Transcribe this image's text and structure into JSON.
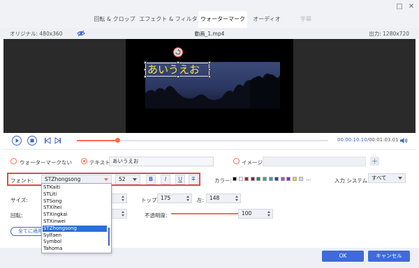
{
  "tabs": [
    {
      "label": "回転 & クロップ",
      "state": "normal"
    },
    {
      "label": "エフェクト & フィルター",
      "state": "normal"
    },
    {
      "label": "ウォーターマーク",
      "state": "active"
    },
    {
      "label": "オーディオ",
      "state": "normal"
    },
    {
      "label": "字幕",
      "state": "disabled"
    }
  ],
  "preview": {
    "original_label": "オリジナル: 480x360",
    "file_name": "動画_1.mp4",
    "output_label": "出力: 1280x720",
    "watermark_text": "あいうえお"
  },
  "playback": {
    "current_time": "00:00:10.10",
    "separator": "/",
    "total_time": "00:01:03.01",
    "progress_fraction": 0.16
  },
  "watermark_mode": {
    "none_label": "ウォーターマークない",
    "text_label": "テキスト",
    "text_value": "あいうえお",
    "image_label": "イメージ",
    "add_symbol": "+"
  },
  "font": {
    "label": "フォント:",
    "selected": "STZhongsong",
    "size": "52",
    "bold": "B",
    "italic": "I",
    "underline": "U",
    "strike": "T",
    "options": [
      "STKaiti",
      "STLiti",
      "STSong",
      "STXihei",
      "STXingkai",
      "STXinwei",
      "STZhongsong",
      "Sylfaen",
      "Symbol",
      "Tahoma"
    ],
    "selected_index": 6
  },
  "color": {
    "label": "カラー:",
    "more": "...",
    "swatches": [
      "#000000",
      "#ffffff",
      "#c0182a",
      "#8a1a4a",
      "#1e8a3a",
      "#2fb84a",
      "#3f8fe0",
      "#2a3fb0",
      "#c03fd0",
      "#7a2fc0",
      "#f0d020",
      "#d8d8d8"
    ]
  },
  "input_system": {
    "label": "入力 システム:",
    "value": "すべて"
  },
  "size": {
    "label": "サイズ:"
  },
  "position": {
    "top_label": "トップ:",
    "top_value": "175",
    "left_label": "左:",
    "left_value": "148"
  },
  "rotation": {
    "label": "回転:"
  },
  "opacity": {
    "label": "不透明度:",
    "value": "100",
    "fraction": 1.0
  },
  "apply_all": "全てに適用",
  "buttons": {
    "ok": "OK",
    "cancel": "キャンセル"
  },
  "colors": {
    "accent": "#3f6ad8",
    "orange": "#ff6a4a",
    "highlight_border": "#e04a44"
  }
}
